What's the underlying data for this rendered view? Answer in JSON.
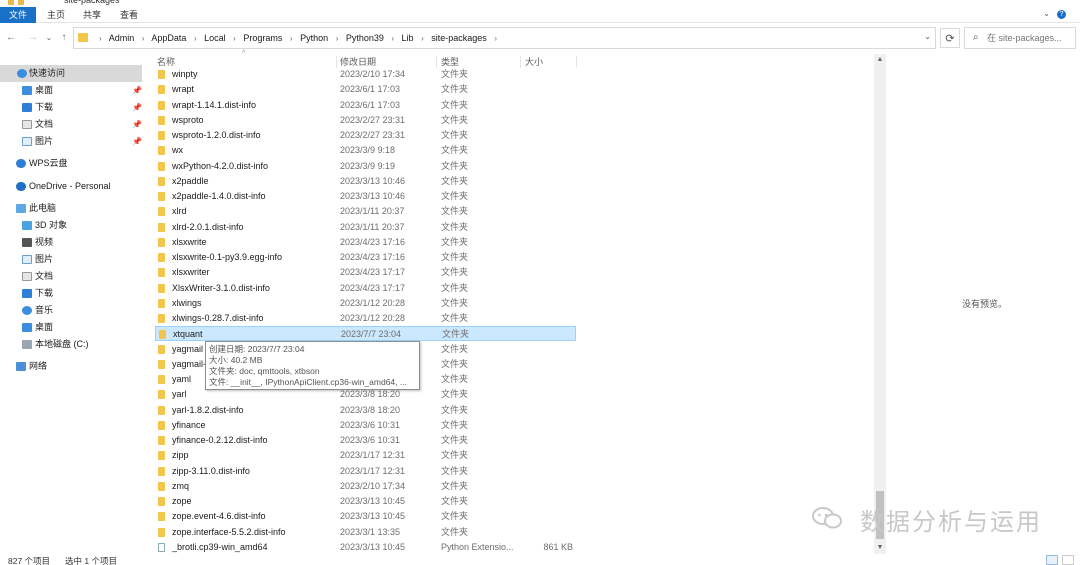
{
  "window": {
    "title": "site-packages"
  },
  "ribbon": {
    "tabs": [
      "文件",
      "主页",
      "共享",
      "查看"
    ]
  },
  "nav": {
    "back_icon": "←",
    "forward_icon": "→",
    "recent_icon": "⌄",
    "up_icon": "↑",
    "refresh_icon": "⟳"
  },
  "address": {
    "crumbs": [
      "Admin",
      "AppData",
      "Local",
      "Programs",
      "Python",
      "Python39",
      "Lib",
      "site-packages"
    ]
  },
  "search": {
    "placeholder": "在 site-packages..."
  },
  "sidebar": {
    "items": [
      {
        "label": "快速访问",
        "icon": "star-icon",
        "pinned": false
      },
      {
        "label": "桌面",
        "icon": "desktop-icon",
        "pinned": true
      },
      {
        "label": "下载",
        "icon": "download-icon",
        "pinned": true
      },
      {
        "label": "文档",
        "icon": "document-icon",
        "pinned": true
      },
      {
        "label": "图片",
        "icon": "picture-icon",
        "pinned": true
      },
      {
        "label": "WPS云盘",
        "icon": "cloud-icon",
        "pinned": false
      },
      {
        "label": "OneDrive - Personal",
        "icon": "onedrive-icon",
        "pinned": false
      },
      {
        "label": "此电脑",
        "icon": "computer-icon",
        "pinned": false
      },
      {
        "label": "3D 对象",
        "icon": "cube-icon",
        "pinned": false
      },
      {
        "label": "视频",
        "icon": "video-icon",
        "pinned": false
      },
      {
        "label": "图片",
        "icon": "picture-icon",
        "pinned": false
      },
      {
        "label": "文档",
        "icon": "document-icon",
        "pinned": false
      },
      {
        "label": "下载",
        "icon": "download-icon",
        "pinned": false
      },
      {
        "label": "音乐",
        "icon": "music-icon",
        "pinned": false
      },
      {
        "label": "桌面",
        "icon": "desktop-icon",
        "pinned": false
      },
      {
        "label": "本地磁盘 (C:)",
        "icon": "drive-icon",
        "pinned": false
      },
      {
        "label": "网络",
        "icon": "network-icon",
        "pinned": false
      }
    ]
  },
  "columns": {
    "name": "名称",
    "date": "修改日期",
    "type": "类型",
    "size": "大小"
  },
  "files": [
    {
      "name": "winpty",
      "date": "2023/2/10 17:34",
      "type": "文件夹",
      "size": ""
    },
    {
      "name": "wrapt",
      "date": "2023/6/1 17:03",
      "type": "文件夹",
      "size": ""
    },
    {
      "name": "wrapt-1.14.1.dist-info",
      "date": "2023/6/1 17:03",
      "type": "文件夹",
      "size": ""
    },
    {
      "name": "wsproto",
      "date": "2023/2/27 23:31",
      "type": "文件夹",
      "size": ""
    },
    {
      "name": "wsproto-1.2.0.dist-info",
      "date": "2023/2/27 23:31",
      "type": "文件夹",
      "size": ""
    },
    {
      "name": "wx",
      "date": "2023/3/9 9:18",
      "type": "文件夹",
      "size": ""
    },
    {
      "name": "wxPython-4.2.0.dist-info",
      "date": "2023/3/9 9:19",
      "type": "文件夹",
      "size": ""
    },
    {
      "name": "x2paddle",
      "date": "2023/3/13 10:46",
      "type": "文件夹",
      "size": ""
    },
    {
      "name": "x2paddle-1.4.0.dist-info",
      "date": "2023/3/13 10:46",
      "type": "文件夹",
      "size": ""
    },
    {
      "name": "xlrd",
      "date": "2023/1/11 20:37",
      "type": "文件夹",
      "size": ""
    },
    {
      "name": "xlrd-2.0.1.dist-info",
      "date": "2023/1/11 20:37",
      "type": "文件夹",
      "size": ""
    },
    {
      "name": "xlsxwrite",
      "date": "2023/4/23 17:16",
      "type": "文件夹",
      "size": ""
    },
    {
      "name": "xlsxwrite-0.1-py3.9.egg-info",
      "date": "2023/4/23 17:16",
      "type": "文件夹",
      "size": ""
    },
    {
      "name": "xlsxwriter",
      "date": "2023/4/23 17:17",
      "type": "文件夹",
      "size": ""
    },
    {
      "name": "XlsxWriter-3.1.0.dist-info",
      "date": "2023/4/23 17:17",
      "type": "文件夹",
      "size": ""
    },
    {
      "name": "xlwings",
      "date": "2023/1/12 20:28",
      "type": "文件夹",
      "size": ""
    },
    {
      "name": "xlwings-0.28.7.dist-info",
      "date": "2023/1/12 20:28",
      "type": "文件夹",
      "size": ""
    },
    {
      "name": "xtquant",
      "date": "2023/7/7 23:04",
      "type": "文件夹",
      "size": "",
      "highlighted": true
    },
    {
      "name": "yagmail",
      "date": "",
      "type": "文件夹",
      "size": ""
    },
    {
      "name": "yagmail-",
      "date": "",
      "type": "文件夹",
      "size": ""
    },
    {
      "name": "yaml",
      "date": "",
      "type": "文件夹",
      "size": ""
    },
    {
      "name": "yarl",
      "date": "2023/3/8 18:20",
      "type": "文件夹",
      "size": ""
    },
    {
      "name": "yarl-1.8.2.dist-info",
      "date": "2023/3/8 18:20",
      "type": "文件夹",
      "size": ""
    },
    {
      "name": "yfinance",
      "date": "2023/3/6 10:31",
      "type": "文件夹",
      "size": ""
    },
    {
      "name": "yfinance-0.2.12.dist-info",
      "date": "2023/3/6 10:31",
      "type": "文件夹",
      "size": ""
    },
    {
      "name": "zipp",
      "date": "2023/1/17 12:31",
      "type": "文件夹",
      "size": ""
    },
    {
      "name": "zipp-3.11.0.dist-info",
      "date": "2023/1/17 12:31",
      "type": "文件夹",
      "size": ""
    },
    {
      "name": "zmq",
      "date": "2023/2/10 17:34",
      "type": "文件夹",
      "size": ""
    },
    {
      "name": "zope",
      "date": "2023/3/13 10:45",
      "type": "文件夹",
      "size": ""
    },
    {
      "name": "zope.event-4.6.dist-info",
      "date": "2023/3/13 10:45",
      "type": "文件夹",
      "size": ""
    },
    {
      "name": "zope.interface-5.5.2.dist-info",
      "date": "2023/3/1 13:35",
      "type": "文件夹",
      "size": ""
    },
    {
      "name": "_brotli.cp39-win_amd64",
      "date": "2023/3/13 10:45",
      "type": "Python Extensio...",
      "size": "861 KB",
      "is_file": true
    }
  ],
  "tooltip": {
    "line1": "创建日期: 2023/7/7 23:04",
    "line2": "大小: 40.2 MB",
    "line3": "文件夹: doc, qmttools, xtbson",
    "line4": "文件: __init__, IPythonApiClient.cp36-win_amd64, ..."
  },
  "preview": {
    "message": "没有预览。"
  },
  "status": {
    "count": "827 个项目",
    "selected": "选中 1 个项目"
  },
  "watermark": {
    "text": "数据分析与运用"
  },
  "colors": {
    "accent": "#1a6fc6",
    "folder": "#f4c54b",
    "selection": "#cce8ff",
    "selection_border": "#99d1ff"
  }
}
